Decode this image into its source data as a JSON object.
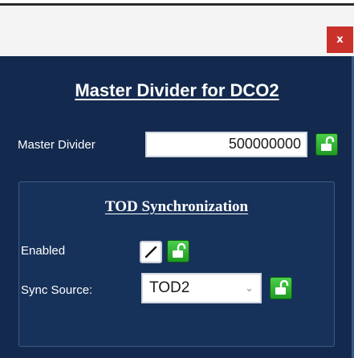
{
  "window": {
    "close_label": "x"
  },
  "panel": {
    "title": "Master Divider for DCO2",
    "master_divider": {
      "label": "Master Divider",
      "value": "500000000"
    },
    "tod_sync": {
      "title": "TOD Synchronization",
      "enabled_label": "Enabled",
      "enabled_checked": true,
      "sync_source_label": "Sync Source:",
      "sync_source_value": "TOD2"
    }
  },
  "colors": {
    "panel_bg": "#132a4e",
    "lock_green": "#2fb534",
    "close_red": "#c9312a"
  },
  "icons": [
    "close-icon",
    "unlock-icon",
    "checkmark-icon",
    "chevron-down-icon"
  ]
}
